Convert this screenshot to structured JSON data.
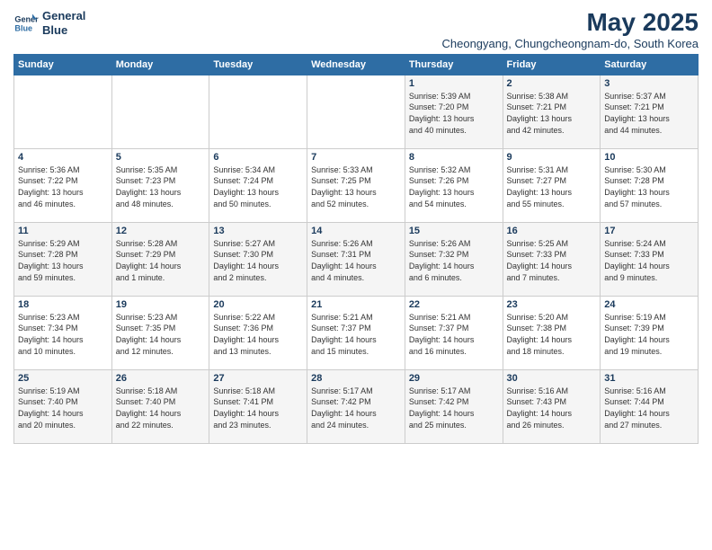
{
  "logo": {
    "line1": "General",
    "line2": "Blue"
  },
  "title": "May 2025",
  "subtitle": "Cheongyang, Chungcheongnam-do, South Korea",
  "weekdays": [
    "Sunday",
    "Monday",
    "Tuesday",
    "Wednesday",
    "Thursday",
    "Friday",
    "Saturday"
  ],
  "weeks": [
    [
      {
        "day": "",
        "info": ""
      },
      {
        "day": "",
        "info": ""
      },
      {
        "day": "",
        "info": ""
      },
      {
        "day": "",
        "info": ""
      },
      {
        "day": "1",
        "info": "Sunrise: 5:39 AM\nSunset: 7:20 PM\nDaylight: 13 hours\nand 40 minutes."
      },
      {
        "day": "2",
        "info": "Sunrise: 5:38 AM\nSunset: 7:21 PM\nDaylight: 13 hours\nand 42 minutes."
      },
      {
        "day": "3",
        "info": "Sunrise: 5:37 AM\nSunset: 7:21 PM\nDaylight: 13 hours\nand 44 minutes."
      }
    ],
    [
      {
        "day": "4",
        "info": "Sunrise: 5:36 AM\nSunset: 7:22 PM\nDaylight: 13 hours\nand 46 minutes."
      },
      {
        "day": "5",
        "info": "Sunrise: 5:35 AM\nSunset: 7:23 PM\nDaylight: 13 hours\nand 48 minutes."
      },
      {
        "day": "6",
        "info": "Sunrise: 5:34 AM\nSunset: 7:24 PM\nDaylight: 13 hours\nand 50 minutes."
      },
      {
        "day": "7",
        "info": "Sunrise: 5:33 AM\nSunset: 7:25 PM\nDaylight: 13 hours\nand 52 minutes."
      },
      {
        "day": "8",
        "info": "Sunrise: 5:32 AM\nSunset: 7:26 PM\nDaylight: 13 hours\nand 54 minutes."
      },
      {
        "day": "9",
        "info": "Sunrise: 5:31 AM\nSunset: 7:27 PM\nDaylight: 13 hours\nand 55 minutes."
      },
      {
        "day": "10",
        "info": "Sunrise: 5:30 AM\nSunset: 7:28 PM\nDaylight: 13 hours\nand 57 minutes."
      }
    ],
    [
      {
        "day": "11",
        "info": "Sunrise: 5:29 AM\nSunset: 7:28 PM\nDaylight: 13 hours\nand 59 minutes."
      },
      {
        "day": "12",
        "info": "Sunrise: 5:28 AM\nSunset: 7:29 PM\nDaylight: 14 hours\nand 1 minute."
      },
      {
        "day": "13",
        "info": "Sunrise: 5:27 AM\nSunset: 7:30 PM\nDaylight: 14 hours\nand 2 minutes."
      },
      {
        "day": "14",
        "info": "Sunrise: 5:26 AM\nSunset: 7:31 PM\nDaylight: 14 hours\nand 4 minutes."
      },
      {
        "day": "15",
        "info": "Sunrise: 5:26 AM\nSunset: 7:32 PM\nDaylight: 14 hours\nand 6 minutes."
      },
      {
        "day": "16",
        "info": "Sunrise: 5:25 AM\nSunset: 7:33 PM\nDaylight: 14 hours\nand 7 minutes."
      },
      {
        "day": "17",
        "info": "Sunrise: 5:24 AM\nSunset: 7:33 PM\nDaylight: 14 hours\nand 9 minutes."
      }
    ],
    [
      {
        "day": "18",
        "info": "Sunrise: 5:23 AM\nSunset: 7:34 PM\nDaylight: 14 hours\nand 10 minutes."
      },
      {
        "day": "19",
        "info": "Sunrise: 5:23 AM\nSunset: 7:35 PM\nDaylight: 14 hours\nand 12 minutes."
      },
      {
        "day": "20",
        "info": "Sunrise: 5:22 AM\nSunset: 7:36 PM\nDaylight: 14 hours\nand 13 minutes."
      },
      {
        "day": "21",
        "info": "Sunrise: 5:21 AM\nSunset: 7:37 PM\nDaylight: 14 hours\nand 15 minutes."
      },
      {
        "day": "22",
        "info": "Sunrise: 5:21 AM\nSunset: 7:37 PM\nDaylight: 14 hours\nand 16 minutes."
      },
      {
        "day": "23",
        "info": "Sunrise: 5:20 AM\nSunset: 7:38 PM\nDaylight: 14 hours\nand 18 minutes."
      },
      {
        "day": "24",
        "info": "Sunrise: 5:19 AM\nSunset: 7:39 PM\nDaylight: 14 hours\nand 19 minutes."
      }
    ],
    [
      {
        "day": "25",
        "info": "Sunrise: 5:19 AM\nSunset: 7:40 PM\nDaylight: 14 hours\nand 20 minutes."
      },
      {
        "day": "26",
        "info": "Sunrise: 5:18 AM\nSunset: 7:40 PM\nDaylight: 14 hours\nand 22 minutes."
      },
      {
        "day": "27",
        "info": "Sunrise: 5:18 AM\nSunset: 7:41 PM\nDaylight: 14 hours\nand 23 minutes."
      },
      {
        "day": "28",
        "info": "Sunrise: 5:17 AM\nSunset: 7:42 PM\nDaylight: 14 hours\nand 24 minutes."
      },
      {
        "day": "29",
        "info": "Sunrise: 5:17 AM\nSunset: 7:42 PM\nDaylight: 14 hours\nand 25 minutes."
      },
      {
        "day": "30",
        "info": "Sunrise: 5:16 AM\nSunset: 7:43 PM\nDaylight: 14 hours\nand 26 minutes."
      },
      {
        "day": "31",
        "info": "Sunrise: 5:16 AM\nSunset: 7:44 PM\nDaylight: 14 hours\nand 27 minutes."
      }
    ]
  ]
}
